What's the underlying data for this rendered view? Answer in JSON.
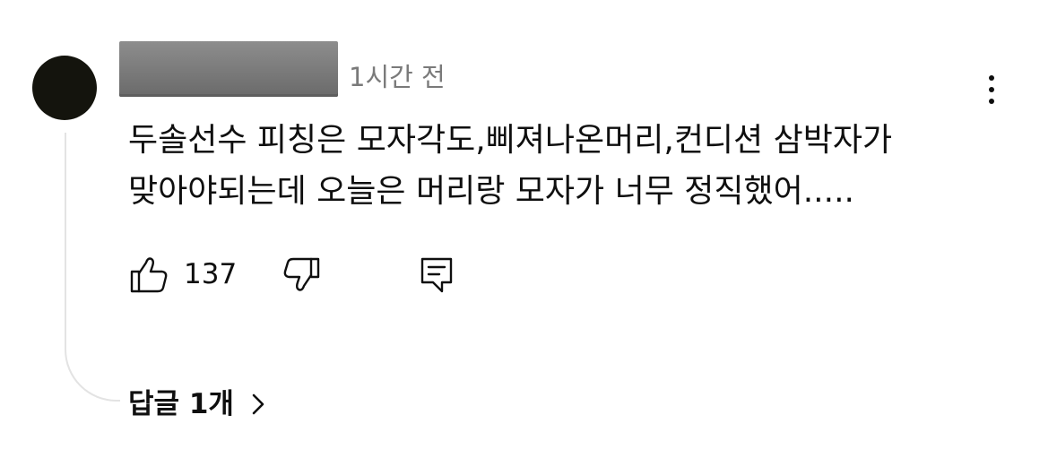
{
  "comment": {
    "author_redacted": true,
    "timestamp": "1시간 전",
    "text_lines": [
      "두솔선수 피칭은 모자각도,삐져나온머리,컨디션 삼박자가",
      "맞아야되는데 오늘은 머리랑 모자가 너무 정직했어....."
    ],
    "like_count": "137",
    "icons": {
      "avatar": "avatar",
      "menu": "more-vertical-icon",
      "like": "thumbs-up-icon",
      "dislike": "thumbs-down-icon",
      "reply": "comment-reply-icon",
      "expand": "chevron-right-icon"
    }
  },
  "replies": {
    "label": "답글 1개"
  },
  "colors": {
    "text": "#0f0f0f",
    "secondary_text": "#7a7a7a",
    "avatar": "#14140d",
    "redaction": "#7a7a7a",
    "thread_line": "#e3e3e3"
  }
}
